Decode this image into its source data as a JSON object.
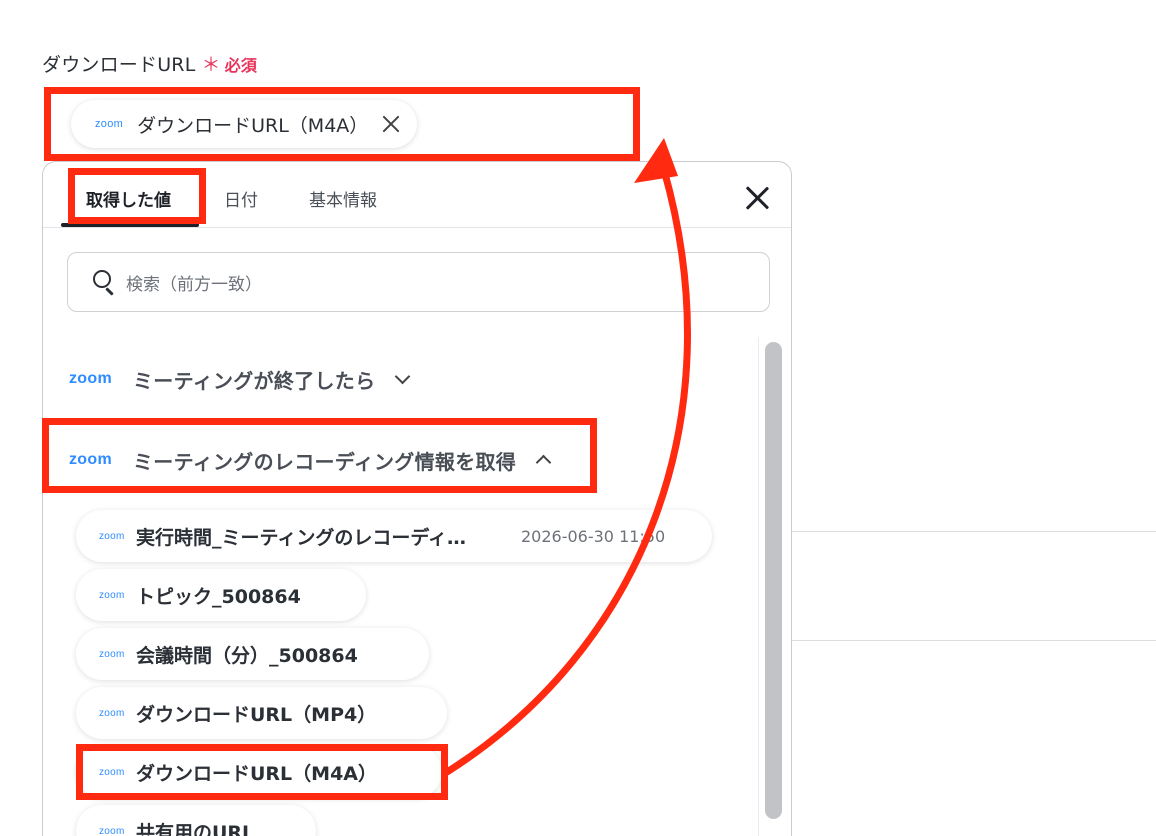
{
  "field": {
    "label": "ダウンロードURL",
    "required_mark": "＊",
    "required_text": "必須"
  },
  "selected_chip": {
    "logo": "zoom",
    "text": "ダウンロードURL（M4A）",
    "remove_icon": "close-icon"
  },
  "tabs": [
    {
      "label": "取得した値",
      "active": true
    },
    {
      "label": "日付",
      "active": false
    },
    {
      "label": "基本情報",
      "active": false
    }
  ],
  "search": {
    "placeholder": "検索（前方一致）"
  },
  "groups": [
    {
      "logo": "zoom",
      "title": "ミーティングが終了したら",
      "expanded": false
    },
    {
      "logo": "zoom",
      "title": "ミーティングのレコーディング情報を取得",
      "expanded": true
    }
  ],
  "items": [
    {
      "logo": "zoom",
      "text": "実行時間_ミーティングのレコーディ…",
      "meta": "2026-06-30 11:50"
    },
    {
      "logo": "zoom",
      "text": "トピック_500864"
    },
    {
      "logo": "zoom",
      "text": "会議時間（分）_500864"
    },
    {
      "logo": "zoom",
      "text": "ダウンロードURL（MP4）"
    },
    {
      "logo": "zoom",
      "text": "ダウンロードURL（M4A）"
    },
    {
      "logo": "zoom",
      "text": "共有用のURL"
    }
  ],
  "colors": {
    "accent_zoom": "#2d8cff",
    "required": "#e8335a",
    "annotation": "#ff2a10"
  }
}
